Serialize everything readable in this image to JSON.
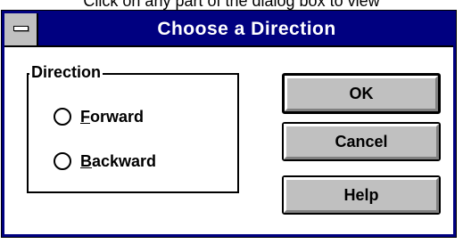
{
  "caption": "Click on any part of the dialog box to view",
  "dialog": {
    "title": "Choose a Direction",
    "group": {
      "label": "Direction",
      "options": [
        {
          "mnemonic": "F",
          "rest": "orward",
          "selected": false
        },
        {
          "mnemonic": "B",
          "rest": "ackward",
          "selected": false
        }
      ]
    },
    "buttons": {
      "ok": "OK",
      "cancel": "Cancel",
      "help": "Help"
    }
  },
  "colors": {
    "title_bar": "#000080",
    "title_text": "#ffffff",
    "button_face": "#c0c0c0",
    "background": "#ffffff"
  },
  "icons": {
    "system_menu": "system-menu-icon"
  }
}
